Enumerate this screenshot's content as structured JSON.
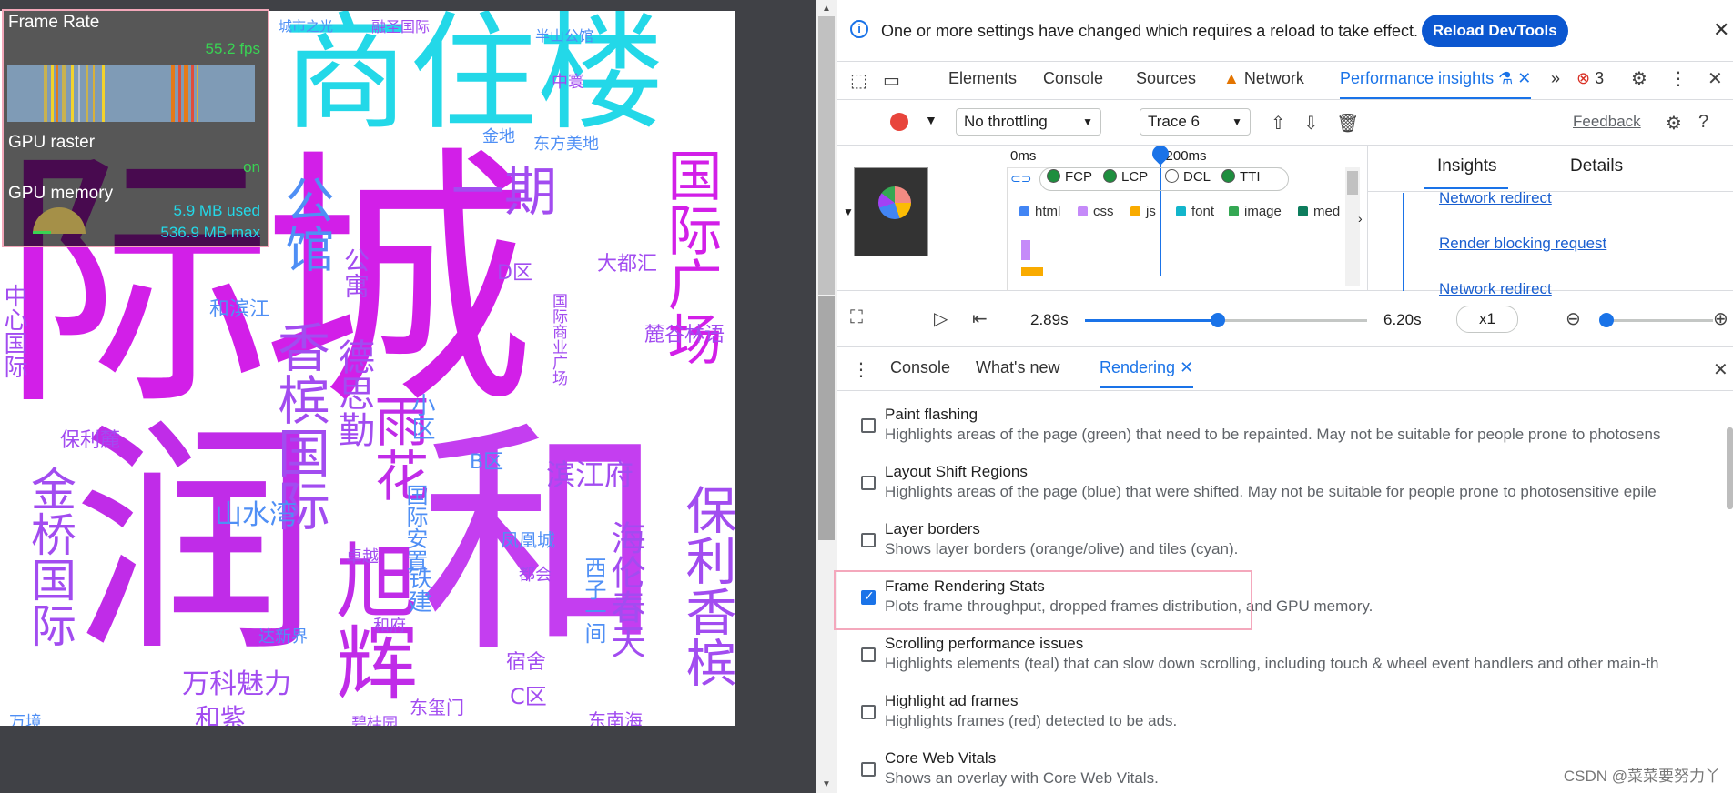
{
  "hud": {
    "frame_rate_label": "Frame Rate",
    "fps": "55.2 fps",
    "gpu_raster_label": "GPU raster",
    "gpu_raster_value": "on",
    "gpu_memory_label": "GPU memory",
    "mem_used": "5.9 MB used",
    "mem_max": "536.9 MB max"
  },
  "wordcloud": {
    "words": [
      "际",
      "城",
      "润",
      "和",
      "商住楼",
      "国际广场",
      "旭辉",
      "香槟国际",
      "保利香槟",
      "海伦春天",
      "德思勤",
      "公馆",
      "一期",
      "公寓",
      "金桥国际",
      "山水湾",
      "滨江府",
      "万科魅力",
      "大都汇",
      "麓谷林语",
      "东方美地",
      "雨花",
      "碧桂园",
      "融圣国际",
      "半山公馆",
      "城市之光",
      "中寰",
      "金地",
      "宿舍",
      "卓越",
      "铁建",
      "和滨江",
      "东南海",
      "国际安置",
      "小区",
      "D区",
      "B区",
      "C区",
      "凤凰城",
      "东玺门",
      "和紫",
      "达新界",
      "万境",
      "中心国际",
      "西子一间",
      "都会",
      "国际商业广场",
      "保利麓",
      "和府"
    ]
  },
  "devtools": {
    "info_message": "One or more settings have changed which requires a reload to take effect.",
    "reload_button": "Reload DevTools",
    "tabs": [
      "Elements",
      "Console",
      "Sources",
      "Network",
      "Performance insights"
    ],
    "error_count": "3",
    "throttling": "No throttling",
    "trace": "Trace 6",
    "feedback": "Feedback",
    "ruler_start": "0ms",
    "ruler_mark": "3,200ms",
    "metrics": [
      "FCP",
      "LCP",
      "DCL",
      "TTI"
    ],
    "legend": [
      {
        "label": "html",
        "color": "#4285f4"
      },
      {
        "label": "css",
        "color": "#c58af9"
      },
      {
        "label": "js",
        "color": "#f9ab00"
      },
      {
        "label": "font",
        "color": "#12b5cb"
      },
      {
        "label": "image",
        "color": "#34a853"
      },
      {
        "label": "med",
        "color": "#0d7d5d"
      }
    ],
    "panel_tabs": [
      "Insights",
      "Details"
    ],
    "insight_links": [
      "Network redirect",
      "Render blocking request",
      "Network redirect"
    ],
    "player": {
      "current": "2.89s",
      "end": "6.20s",
      "speed": "x1",
      "progress": 0.47
    },
    "drawer_tabs": [
      "Console",
      "What's new",
      "Rendering"
    ],
    "rendering_options": [
      {
        "title": "Paint flashing",
        "desc": "Highlights areas of the page (green) that need to be repainted. May not be suitable for people prone to photosens",
        "checked": false
      },
      {
        "title": "Layout Shift Regions",
        "desc": "Highlights areas of the page (blue) that were shifted. May not be suitable for people prone to photosensitive epile",
        "checked": false
      },
      {
        "title": "Layer borders",
        "desc": "Shows layer borders (orange/olive) and tiles (cyan).",
        "checked": false
      },
      {
        "title": "Frame Rendering Stats",
        "desc": "Plots frame throughput, dropped frames distribution, and GPU memory.",
        "checked": true
      },
      {
        "title": "Scrolling performance issues",
        "desc": "Highlights elements (teal) that can slow down scrolling, including touch & wheel event handlers and other main-th",
        "checked": false
      },
      {
        "title": "Highlight ad frames",
        "desc": "Highlights frames (red) detected to be ads.",
        "checked": false
      },
      {
        "title": "Core Web Vitals",
        "desc": "Shows an overlay with Core Web Vitals.",
        "checked": false
      }
    ],
    "watermark": "CSDN @菜菜要努力丫"
  },
  "colors": {
    "accent": "#1a73e8",
    "magenta": "#d21fe8",
    "cyan": "#23d8e8",
    "purple": "#a24cf0",
    "blue": "#4f8ff5"
  }
}
